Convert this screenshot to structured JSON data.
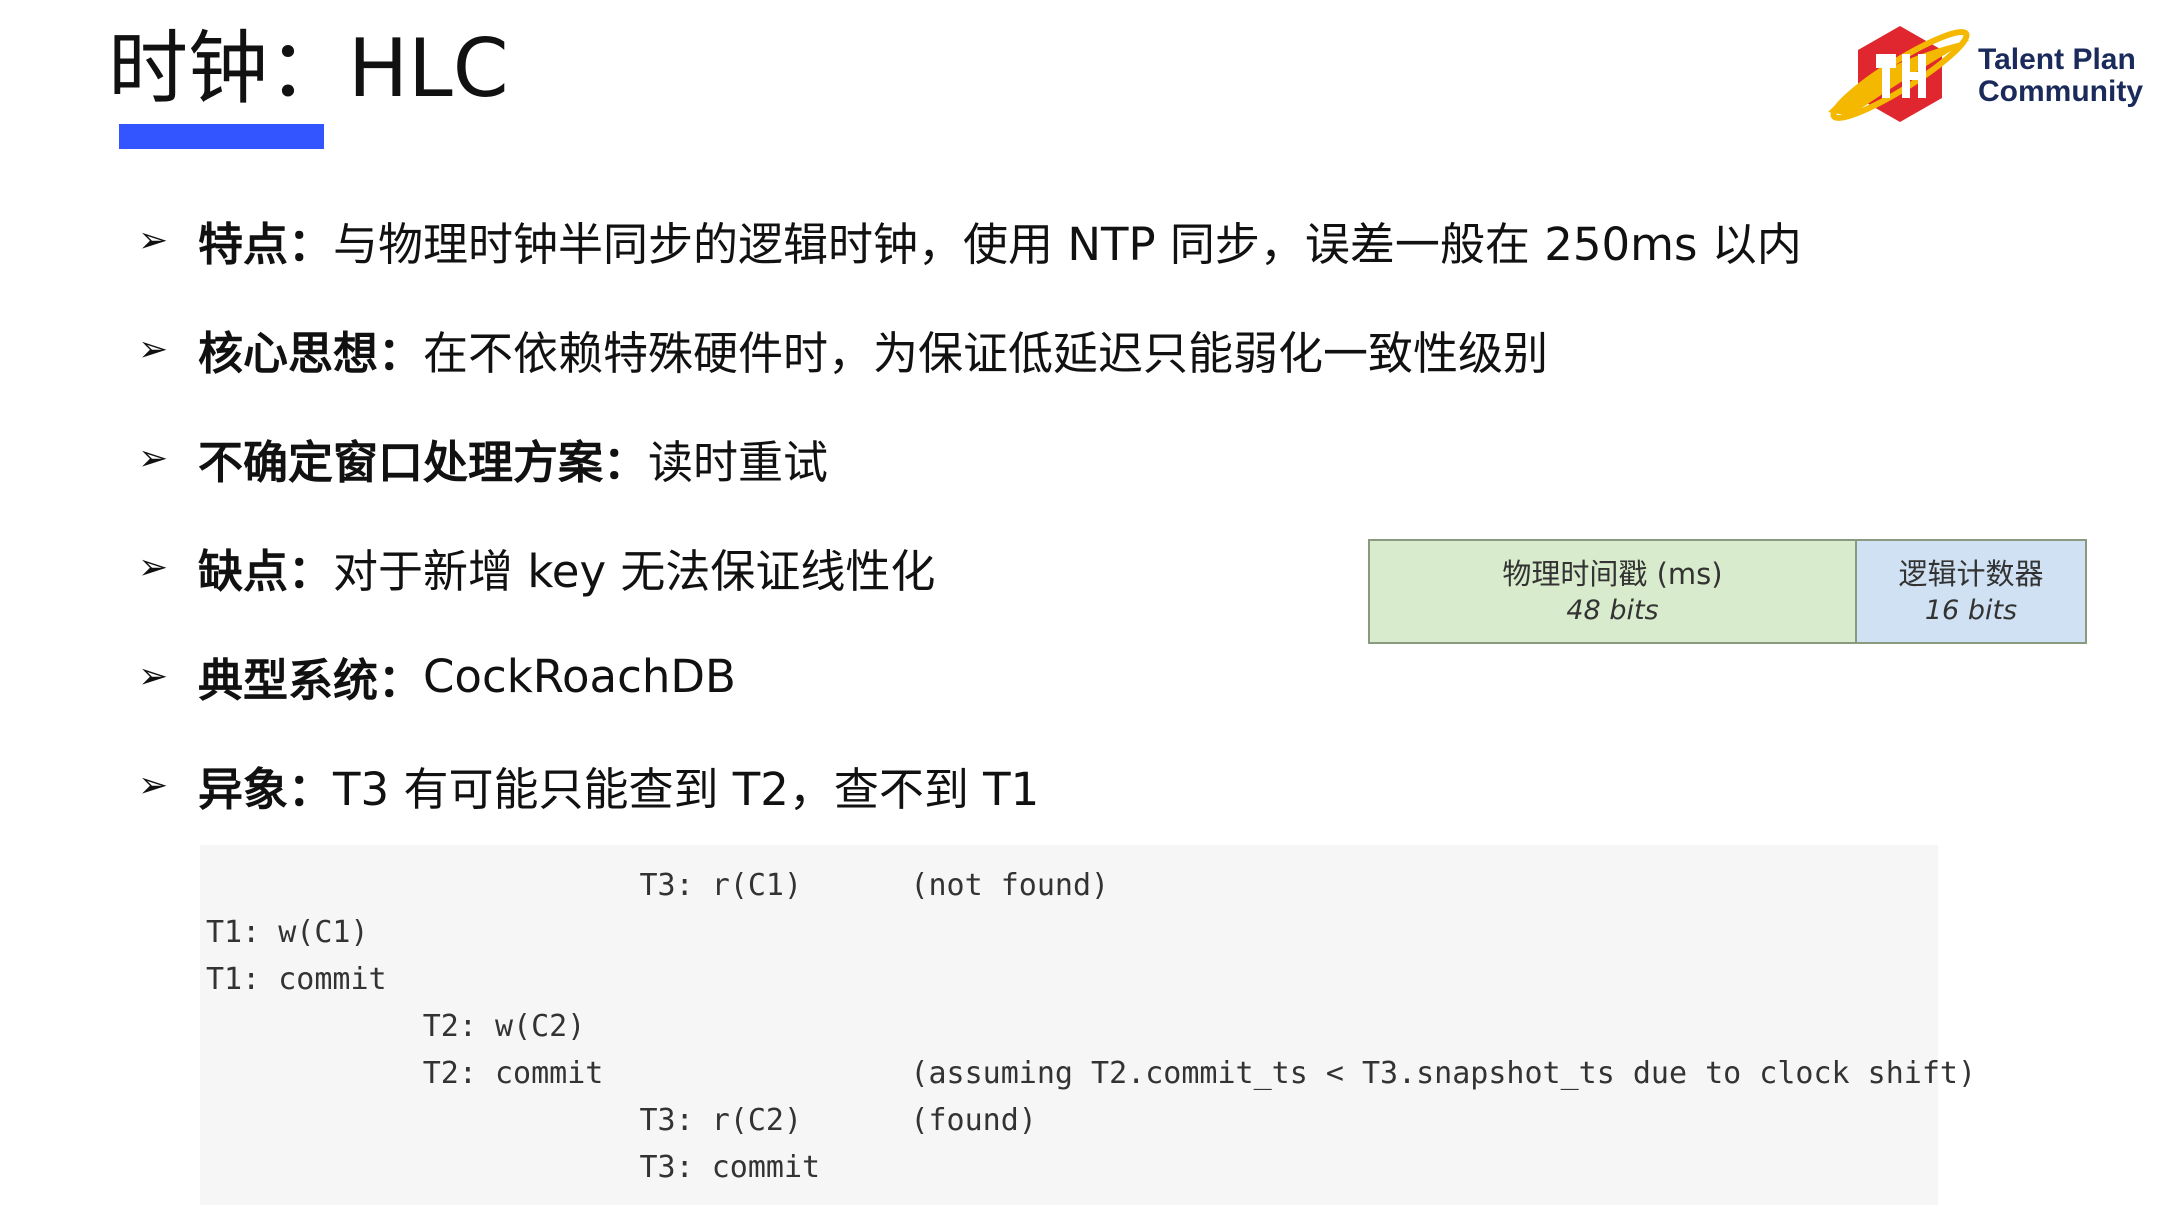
{
  "slide": {
    "title": "时钟：HLC"
  },
  "logo": {
    "line1": "Talent Plan",
    "line2": "Community"
  },
  "bullets": [
    {
      "arrow": "➢",
      "key": "特点：",
      "value": "与物理时钟半同步的逻辑时钟，使用 NTP 同步，误差一般在 250ms 以内"
    },
    {
      "arrow": "➢",
      "key": "核心思想：",
      "value": "在不依赖特殊硬件时，为保证低延迟只能弱化一致性级别"
    },
    {
      "arrow": "➢",
      "key": "不确定窗口处理方案：",
      "value": "读时重试"
    },
    {
      "arrow": "➢",
      "key": "缺点：",
      "value": "对于新增 key 无法保证线性化"
    },
    {
      "arrow": "➢",
      "key": "典型系统：",
      "value": "CockRoachDB"
    },
    {
      "arrow": "➢",
      "key": "异象：",
      "value": "T3 有可能只能查到 T2，查不到 T1"
    }
  ],
  "hlc_layout": {
    "physical": {
      "label": "物理时间戳 (ms)",
      "bits": "48 bits"
    },
    "logical": {
      "label": "逻辑计数器",
      "bits": "16 bits"
    }
  },
  "code": [
    "                        T3: r(C1)      (not found)",
    "T1: w(C1)",
    "T1: commit",
    "            T2: w(C2)",
    "            T2: commit                 (assuming T2.commit_ts < T3.snapshot_ts due to clock shift)",
    "                        T3: r(C2)      (found)",
    "                        T3: commit"
  ]
}
